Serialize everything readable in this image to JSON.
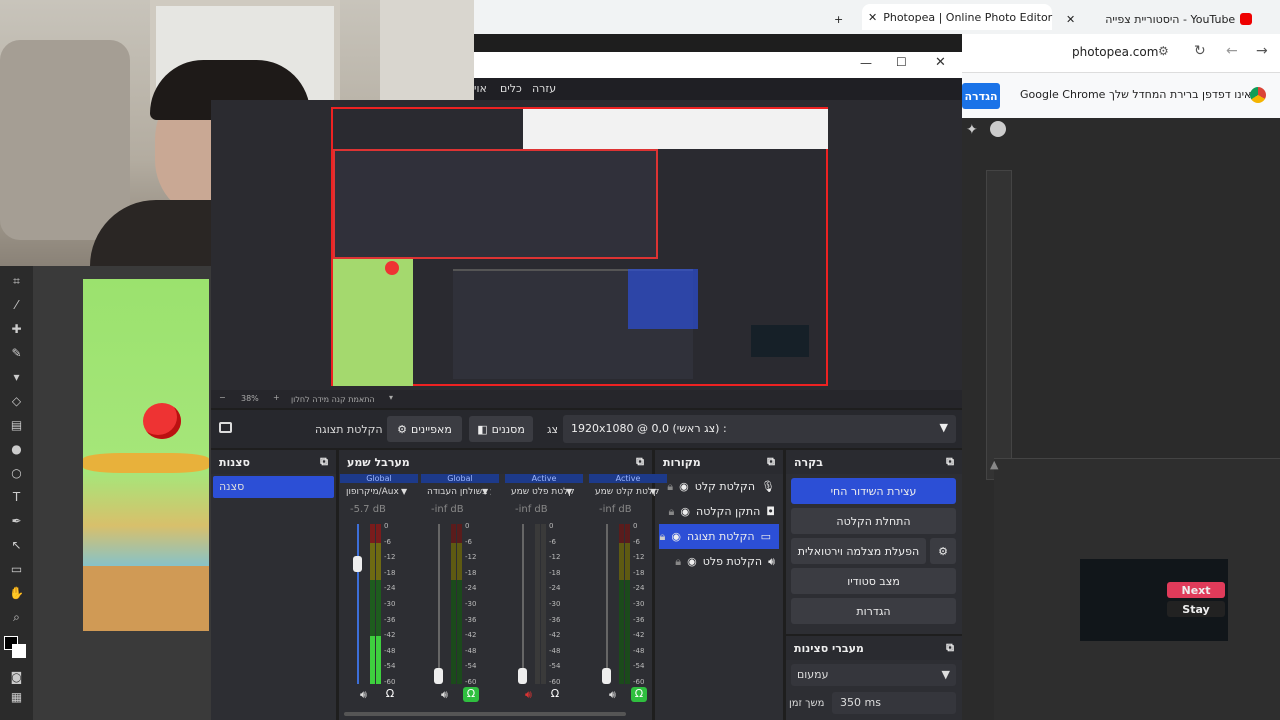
{
  "chrome": {
    "tab_active": "Photopea | Online Photo Editor",
    "tab_other": "היסטוריית צפייה - YouTube",
    "address": "photopea.com",
    "infobar_text": "Google Chrome אינו דפדפן ברירת המחדל שלך",
    "infobar_button": "הגדרה"
  },
  "obs": {
    "menu": [
      "עזרה",
      "כלים",
      "אוי"
    ],
    "zoom": "38%",
    "status_note": "התאמת קנה מידה לחלון",
    "toolbar": {
      "display_capture": "הקלטת תצוגה",
      "properties": "מאפיינים",
      "filters": "מסננים",
      "resolution_label": "צג",
      "resolution": "1920x1080 @ 0,0 (צג ראשי) :"
    },
    "scenes": {
      "title": "סצנות",
      "items": [
        "סצנה"
      ]
    },
    "mixer": {
      "title": "מערבל שמע",
      "channels": [
        {
          "tag": "Global",
          "name": "מיקרופון/Aux",
          "db": "-5.7 dB"
        },
        {
          "tag": "Global",
          "name": "שמע בשולחן העבודה",
          "db": "-inf dB"
        },
        {
          "tag": "Active",
          "name": "הקלטת פלט שמע",
          "db": "-inf dB"
        },
        {
          "tag": "Active",
          "name": "הקלטת קלט שמע",
          "db": "-inf dB"
        }
      ],
      "ticks": [
        "0",
        "-6",
        "-12",
        "-18",
        "-24",
        "-30",
        "-36",
        "-42",
        "-48",
        "-54",
        "-60"
      ]
    },
    "sources": {
      "title": "מקורות",
      "items": [
        "הקלטת קלט",
        "התקן הקלטה",
        "הקלטת תצוגה",
        "הקלטת פלט"
      ]
    },
    "controls": {
      "title": "בקרה",
      "buttons": [
        "עצירת השידור החי",
        "התחלת הקלטה",
        "הפעלת מצלמה וירטואלית",
        "מצב סטודיו",
        "הגדרות"
      ]
    },
    "transitions": {
      "title": "מעברי סצינות",
      "type": "עמעום",
      "duration_label": "משך זמן",
      "duration": "350 ms"
    }
  },
  "popup": {
    "next": "Next",
    "stay": "Stay"
  },
  "colors": {
    "accent": "#2c4fd6",
    "green": "#2fbf3f",
    "red": "#d33"
  }
}
